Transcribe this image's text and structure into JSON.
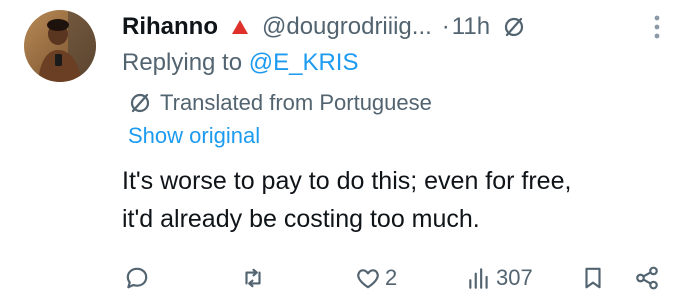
{
  "author": {
    "name": "Rihanno",
    "handle": "@dougrodriiig...",
    "separator": "·",
    "time": "11h"
  },
  "reply": {
    "prefix": "Replying to ",
    "mention": "@E_KRIS"
  },
  "translation": {
    "label": "Translated from Portuguese",
    "show_original": "Show original"
  },
  "tweet": {
    "line1": "It's worse to pay to do this; even for free,",
    "line2": "it'd already be costing too much."
  },
  "actions": {
    "reply_count": "",
    "retweet_count": "",
    "like_count": "2",
    "view_count": "307"
  },
  "colors": {
    "text_primary": "#0f1419",
    "text_secondary": "#536471",
    "link": "#1d9bf0",
    "flag": "#e0302a"
  },
  "icons": {
    "flag": "red-triangle-icon",
    "translate_header": "translate-icon",
    "more": "more-vertical-icon",
    "reply": "reply-icon",
    "retweet": "retweet-icon",
    "like": "heart-icon",
    "views": "views-icon",
    "bookmark": "bookmark-icon",
    "share": "share-icon"
  }
}
